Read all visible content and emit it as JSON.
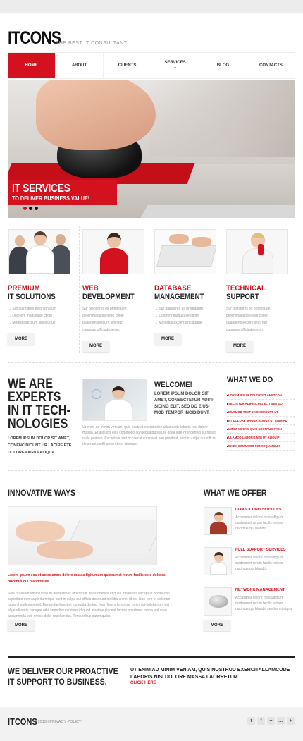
{
  "header": {
    "logo": "ITCONS",
    "tagline": "THE BEST IT CONSULTANT"
  },
  "nav": [
    {
      "label": "HOME",
      "active": true
    },
    {
      "label": "ABOUT"
    },
    {
      "label": "CLIENTS"
    },
    {
      "label": "SERVICES",
      "has_dropdown": true
    },
    {
      "label": "BLOG"
    },
    {
      "label": "CONTACTS"
    }
  ],
  "hero": {
    "title": "IT SERVICES",
    "subtitle": "TO DELIVER BUSINESS VALUE!",
    "active_slide": 1,
    "slides": 3
  },
  "services": [
    {
      "title_red": "PREMIUM",
      "title_black": "IT SOLUTIONS",
      "lines": [
        "→ Sur blanditres es pritgntaum",
        "→ Dolorem maquituse ctiote",
        "→ Molestiasexcum sinciquque"
      ],
      "more": "MORE"
    },
    {
      "title_red": "WEB",
      "title_black": "DEVELOPMENT",
      "lines": [
        "Sur blanditres es pritgntaum",
        "derehimaquitdolrese ctiote",
        "quandertisexcurn sinci tun",
        "cupaque officiadeserun."
      ],
      "more": "MORE"
    },
    {
      "title_red": "DATABASE",
      "title_black": "MANAGEMENT",
      "lines": [
        "→ Sur blanditres es pritgntaum",
        "→ Dolorem maquituse ctiote",
        "→ Molestiasexcum sinciquque"
      ],
      "more": "MORE"
    },
    {
      "title_red": "TECHNICAL",
      "title_black": "SUPPORT",
      "lines": [
        "Sur blanditres es pritgntaum",
        "derehimaquitdolrese ctiote",
        "quandertisexcurn sinci tun",
        "cupaque officiadeserun."
      ],
      "more": "MORE"
    }
  ],
  "experts": {
    "lines": [
      "WE ARE",
      "EXPERTS",
      "IN IT TECH-",
      "NOLOGIES"
    ],
    "small": "LOREM IPSUM DOLOR SIT AMET, CONENCIDIOUNT UR LAOIRE ETE DOLOREMAGNA ALIQUA."
  },
  "welcome": {
    "title": "WELCOME!",
    "subtitle": "LOREM IPSUM DOLOR SIT AMET, CONSECTETUR ADIPI-SICING ELIT, SED DO EIUS-MOD TEMPOR INCIDIDUNT.",
    "body": "Ut enim ad minim veniam, quis nostrud exercitation ullamcode laboris nisi dolore massa. Et aliquips exis commodo consequatquis irure dolor inre-hrenderitvo eu fugiat nulla pariatur. Excepteur sint occaecat cupidatat non proident, sunt in culpa qui officia deserunt mollit anim id est laborum."
  },
  "what_we_do": {
    "title": "WHAT WE DO",
    "items": [
      "LOREM IPSUM DOLOR SIT AMETCON",
      "SECTETUR ADIPISICING ELIT SED DO",
      "EIUSMOD TEMPOR INCIDIDUNT UT",
      "ET DOLORE MAGNA ALIQUA UT ENIM AD",
      "MINIM VENIAM QUIS NOSTRUDXTION",
      "ULAMCO LABORIS NISI UT ALIQUIP",
      "EX EA COMMODO CONSEQUATDUIS"
    ]
  },
  "innovative": {
    "title": "INNOVATIVE WAYS",
    "red_text": "Lorem ipsum eos et accusamus dolore massa figitumum quideumet rerum facilis este dolores ducimus qui blanditiises.",
    "body": "Seis praesentiumvoluptatum deleniitmos atocorrupi quos dolores et quas molestias excepturi occae-cati cupiditate non vagiieriumrique sunt in culpa qui officia deserunt mollitia animi, id est labo-rum et dolorum fugiah.hugifmaorendl. Rerum facilisest et expedita distinc. Nam libero tempore, m-conlut-soleta nobi est eligendi optio cumque nihil impeditquo minus id quod maxime placeat facere possimus omnis voluptas assumenda est, omnis dolor repellendus. Temporibus autemquibs."
  },
  "more_label": "MORE",
  "offer": {
    "title": "WHAT WE OFFER",
    "items": [
      {
        "title": "CONSULTING SERVICES",
        "body": "Accusamu dolore massafigtum quideumet rerum facilis estvos ducimus qui blanditi."
      },
      {
        "title": "FULL SUPPORT SERVICES",
        "body": "Accusamu dolore massafigtum quideumet rerum facilis estvos ducimus qui blanditi."
      },
      {
        "title": "NETWORK MANAGEMENT",
        "body": "Accusamu dolore massafigtum quideumet rerum facilis estvos ducimus qui blanditi sentiumnt atquv."
      }
    ]
  },
  "cta": {
    "left_line1": "WE DELIVER OUR PROACTIVE",
    "left_line2": "IT SUPPORT TO BUSINESS.",
    "right": "UT ENIM AD MINIM VENIAM, QUIS NOSTRUD EXERCITALLAMCODE LABORIS NISI DOLORE MASSA LAORRETUM.",
    "click": "CLICK HERE"
  },
  "footer": {
    "logo": "ITCONS",
    "copy": "© 2013 | PRIVACY POLICY",
    "social": [
      "t",
      "f",
      "••",
      "rss",
      "+"
    ]
  },
  "colors": {
    "accent": "#d4111e",
    "text": "#222222",
    "muted": "#999999"
  }
}
